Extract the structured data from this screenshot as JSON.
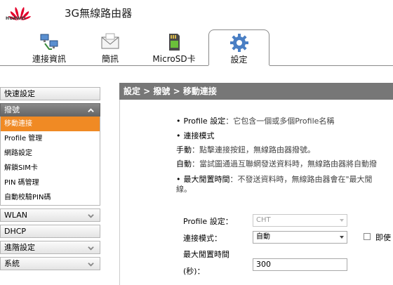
{
  "header": {
    "brand": "HUAWEI",
    "title": "3G無線路由器",
    "tabs": [
      {
        "label": "連接資訊",
        "icon": "network-computers-icon"
      },
      {
        "label": "簡訊",
        "icon": "envelope-icon"
      },
      {
        "label": "MicroSD卡",
        "icon": "sd-card-icon"
      },
      {
        "label": "設定",
        "icon": "gear-icon",
        "active": true
      }
    ]
  },
  "sidebar": {
    "quick_setup": "快速設定",
    "dialup": {
      "label": "撥號",
      "items": [
        "移動連接",
        "Profile 管理",
        "網路設定",
        "解鎖SIM卡",
        "PIN 碼管理",
        "自動校驗PIN碼"
      ],
      "active_index": 0
    },
    "wlan": "WLAN",
    "dhcp": "DHCP",
    "advanced": "進階設定",
    "system": "系統"
  },
  "content": {
    "breadcrumb": "設定 > 撥號 > 移動連接",
    "help": {
      "bullet": "•",
      "profile_term": "Profile 設定",
      "profile_desc": "：它包含一個或多個Profile名稱",
      "conn_mode_title": "連接模式",
      "manual_term": "手動",
      "manual_desc": "：點擊連接按鈕，無線路由器撥號。",
      "auto_term": "自動",
      "auto_desc": "：當試圖通過互聯網發送資料時，無線路由器將自動撥",
      "idle_term": "最大閒置時間",
      "idle_desc": "：不發送資料時，無線路由器會在\"最大閒",
      "idle_desc_wrap": "線。"
    },
    "form": {
      "profile_label": "Profile 設定：",
      "profile_value": "CHT",
      "mode_label": "連接模式：",
      "mode_value": "自動",
      "immediate_label": "即使",
      "idle_label_1": "最大閒置時間",
      "idle_label_2": "(秒)：",
      "idle_value": "300"
    }
  },
  "colors": {
    "accent_orange": "#f08a24",
    "header_gray": "#777777",
    "logo_red": "#e4002b"
  }
}
